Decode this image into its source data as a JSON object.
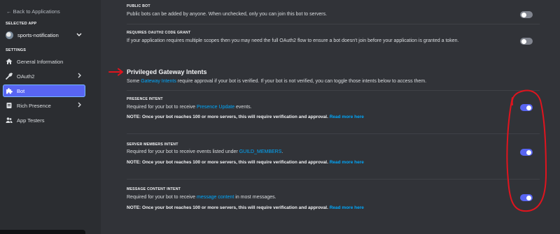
{
  "sidebar": {
    "back_label": "← Back to Applications",
    "selected_app_heading": "SELECTED APP",
    "app_name": "sports-notification",
    "settings_heading": "SETTINGS",
    "items": [
      {
        "label": "General Information",
        "icon": "home-icon",
        "has_chevron": false
      },
      {
        "label": "OAuth2",
        "icon": "wrench-icon",
        "has_chevron": true
      },
      {
        "label": "Bot",
        "icon": "puzzle-icon",
        "has_chevron": false,
        "active": true
      },
      {
        "label": "Rich Presence",
        "icon": "document-icon",
        "has_chevron": true
      },
      {
        "label": "App Testers",
        "icon": "users-icon",
        "has_chevron": false
      }
    ]
  },
  "public_bot": {
    "heading": "PUBLIC BOT",
    "description": "Public bots can be added by anyone. When unchecked, only you can join this bot to servers.",
    "enabled": false
  },
  "oauth2_grant": {
    "heading": "REQUIRES OAUTH2 CODE GRANT",
    "description": "If your application requires multiple scopes then you may need the full OAuth2 flow to ensure a bot doesn't join before your application is granted a token.",
    "enabled": false
  },
  "privileged": {
    "title": "Privileged Gateway Intents",
    "desc_before": "Some ",
    "desc_link": "Gateway Intents",
    "desc_after": " require approval if your bot is verified. If your bot is not verified, you can toggle those intents below to access them."
  },
  "intents": [
    {
      "heading": "PRESENCE INTENT",
      "desc_before": "Required for your bot to receive ",
      "desc_link": "Presence Update",
      "desc_after": " events.",
      "note": "NOTE: Once your bot reaches 100 or more servers, this will require verification and approval. ",
      "note_link": "Read more here",
      "enabled": true
    },
    {
      "heading": "SERVER MEMBERS INTENT",
      "desc_before": "Required for your bot to receive events listed under ",
      "desc_link": "GUILD_MEMBERS",
      "desc_after": ".",
      "note": "NOTE: Once your bot reaches 100 or more servers, this will require verification and approval. ",
      "note_link": "Read more here",
      "enabled": true
    },
    {
      "heading": "MESSAGE CONTENT INTENT",
      "desc_before": "Required for your bot to receive ",
      "desc_link": "message content",
      "desc_after": " in most messages.",
      "note": "NOTE: Once your bot reaches 100 or more servers, this will require verification and approval. ",
      "note_link": "Read more here",
      "enabled": true
    }
  ],
  "colors": {
    "accent": "#5865f2",
    "link": "#00a8fc",
    "annotation": "#e0141e",
    "background": "#313338",
    "sidebar": "#2b2d31"
  }
}
